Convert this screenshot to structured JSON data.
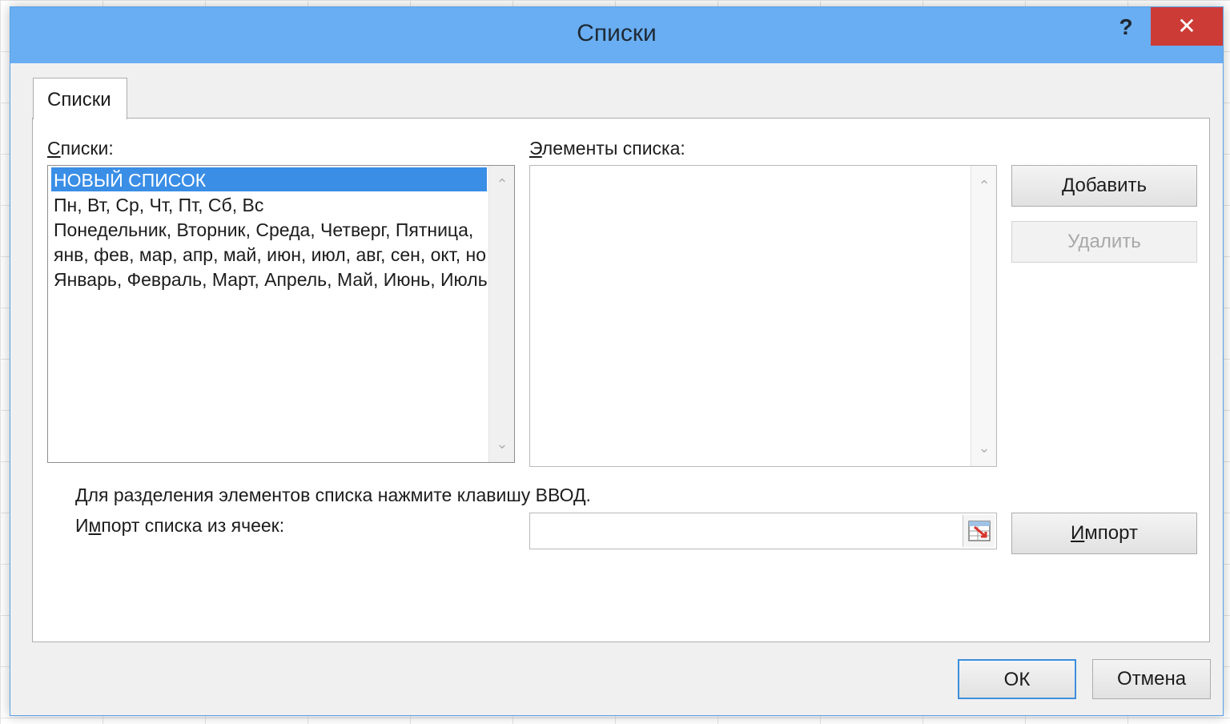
{
  "window": {
    "title": "Списки",
    "help_label": "?",
    "close_label": "✕"
  },
  "tabs": [
    {
      "label": "Списки",
      "selected": true
    }
  ],
  "lists_section": {
    "label_underlined": "С",
    "label_rest": "писки:",
    "items": [
      {
        "text": "НОВЫЙ СПИСОК",
        "selected": true
      },
      {
        "text": "Пн, Вт, Ср, Чт, Пт, Сб, Вс",
        "selected": false
      },
      {
        "text": "Понедельник, Вторник, Среда, Четверг, Пятница,",
        "selected": false
      },
      {
        "text": "янв, фев, мар, апр, май, июн, июл, авг, сен, окт, но",
        "selected": false
      },
      {
        "text": "Январь, Февраль, Март, Апрель, Май, Июнь, Июль,",
        "selected": false
      }
    ]
  },
  "elements_section": {
    "label_underlined": "Э",
    "label_rest": "лементы списка:",
    "value": ""
  },
  "buttons": {
    "add_underlined": "Д",
    "add_rest": "обавить",
    "delete_label": "Удалить",
    "import_prefix": "",
    "import_underlined": "И",
    "import_rest": "мпорт",
    "ok_label": "ОК",
    "cancel_label": "Отмена"
  },
  "hint_text": "Для разделения элементов списка нажмите клавишу ВВОД.",
  "import_section": {
    "label_prefix": "И",
    "label_underlined": "м",
    "label_rest": "порт списка из ячеек:",
    "value": ""
  },
  "icons": {
    "help": "help-icon",
    "close": "close-icon",
    "scroll_up": "chevron-up-icon",
    "scroll_down": "chevron-down-icon",
    "range_select": "range-select-icon"
  },
  "colors": {
    "titlebar": "#69aef2",
    "close_button": "#cd3b36",
    "selection": "#3a8ee6",
    "default_button_border": "#3c8fdc"
  }
}
